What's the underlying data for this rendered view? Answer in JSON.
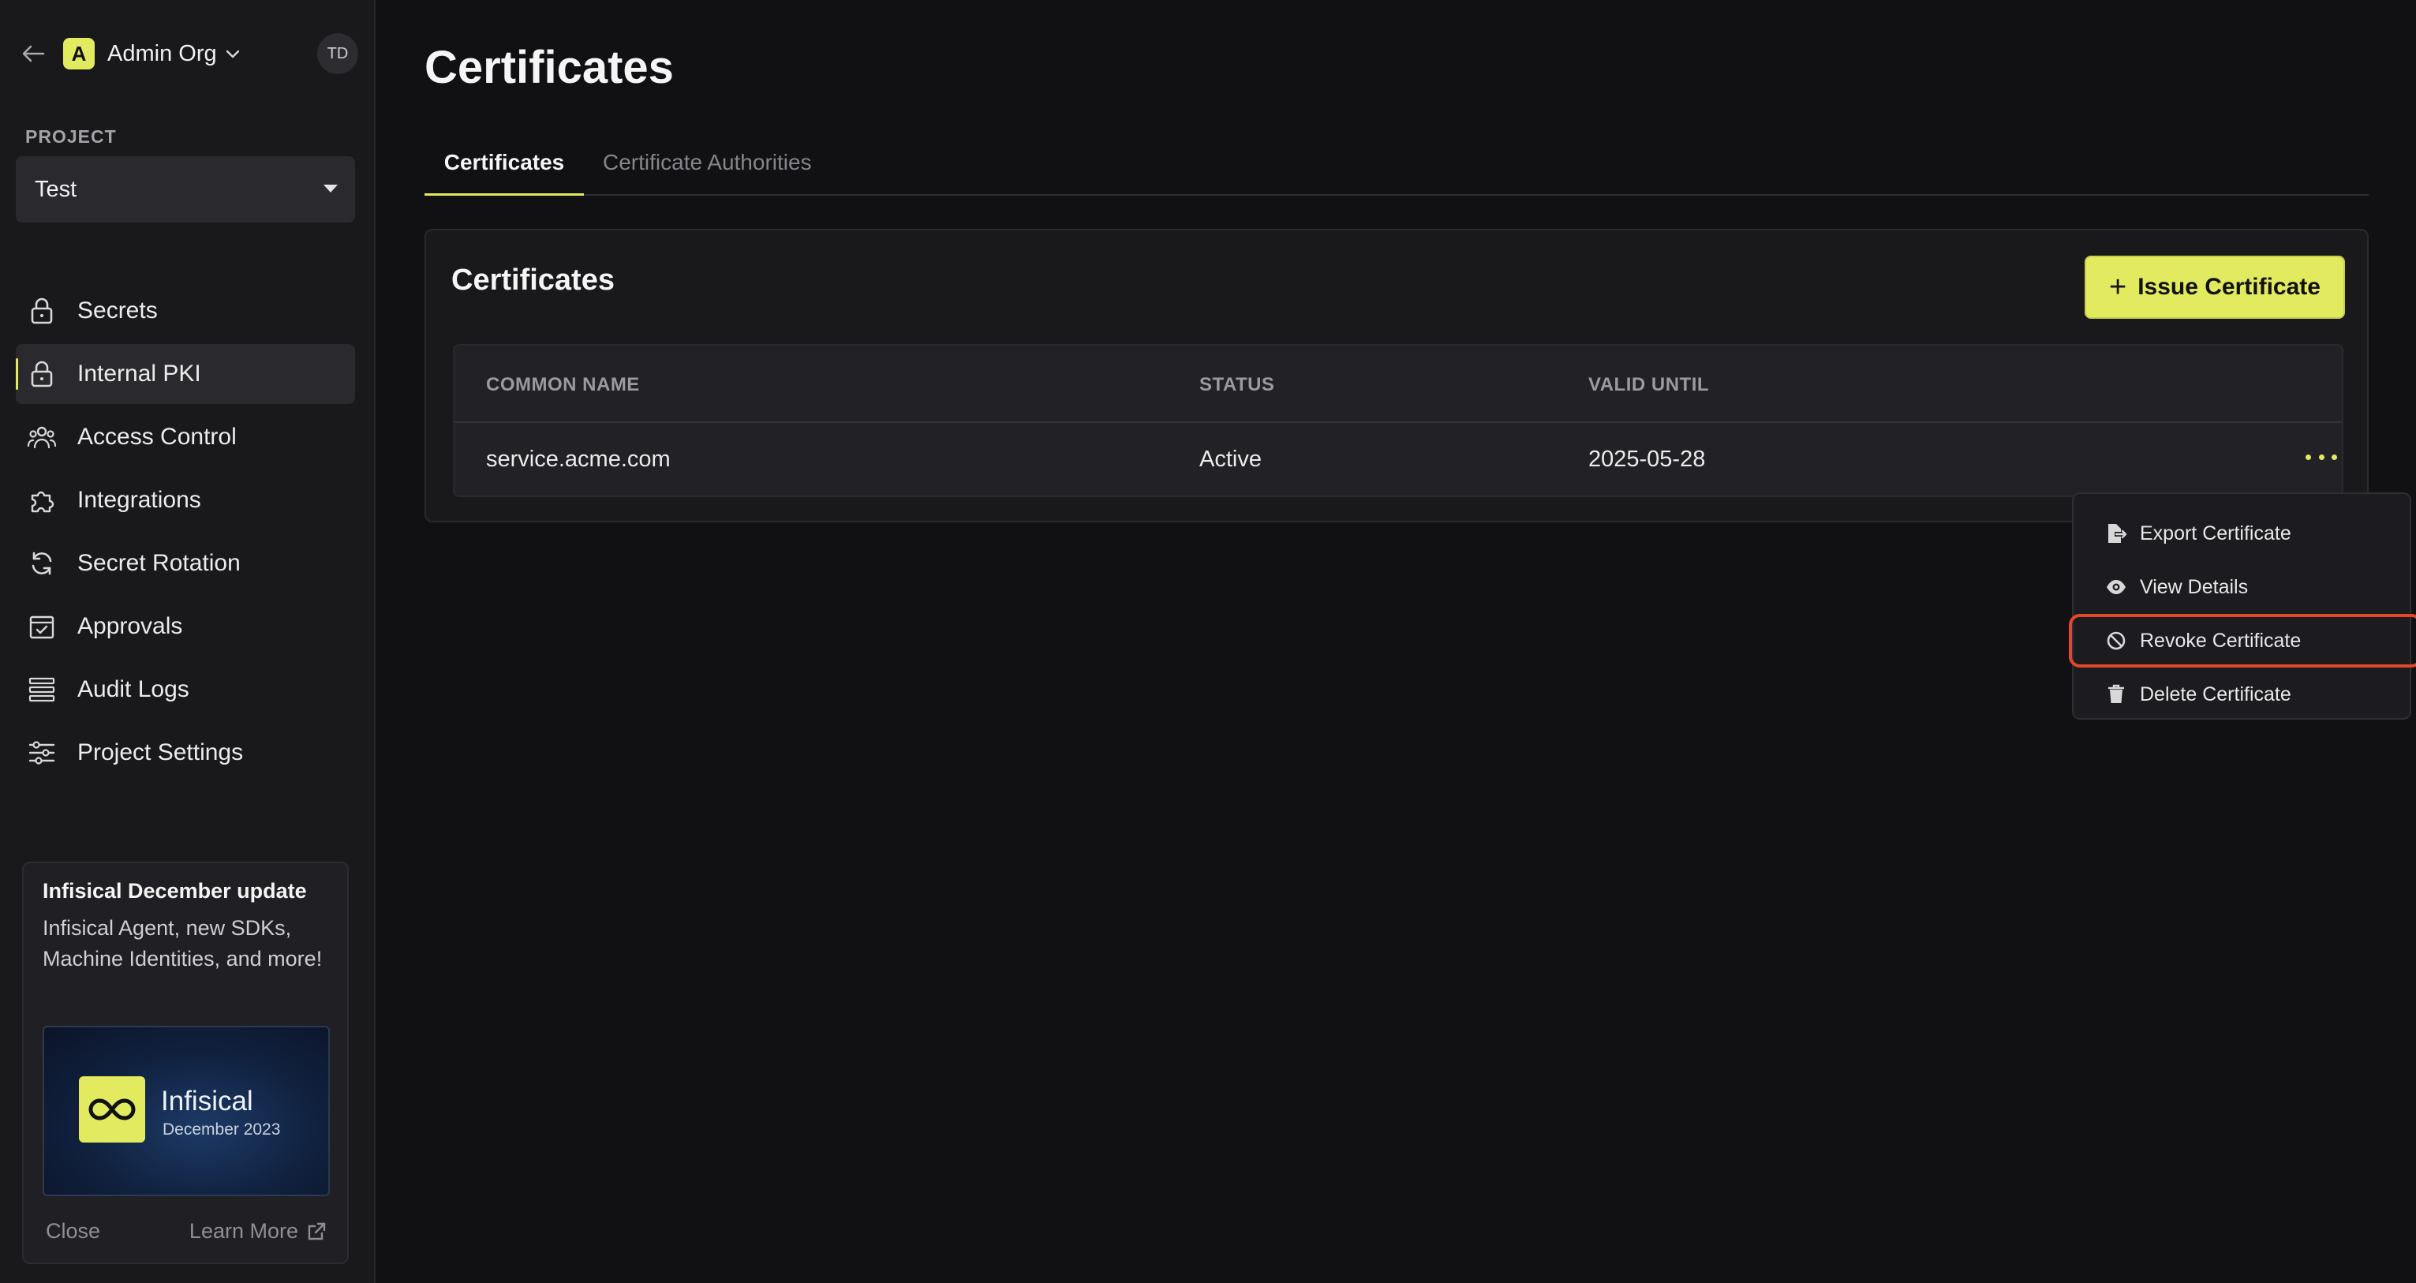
{
  "sidebar": {
    "org_initial": "A",
    "org_name": "Admin Org",
    "avatar_initials": "TD",
    "project_label": "PROJECT",
    "project_value": "Test",
    "nav": [
      {
        "label": "Secrets",
        "icon": "lock-icon"
      },
      {
        "label": "Internal PKI",
        "icon": "lock-icon",
        "active": true
      },
      {
        "label": "Access Control",
        "icon": "users-icon"
      },
      {
        "label": "Integrations",
        "icon": "puzzle-icon"
      },
      {
        "label": "Secret Rotation",
        "icon": "rotate-icon"
      },
      {
        "label": "Approvals",
        "icon": "calendar-check-icon"
      },
      {
        "label": "Audit Logs",
        "icon": "list-icon"
      },
      {
        "label": "Project Settings",
        "icon": "sliders-icon"
      }
    ],
    "update_card": {
      "title": "Infisical December update",
      "text": "Infisical Agent, new SDKs, Machine Identities, and more!",
      "brand_name": "Infisical",
      "brand_sub": "December 2023",
      "close_label": "Close",
      "learn_more_label": "Learn More"
    }
  },
  "main": {
    "title": "Certificates",
    "tabs": [
      {
        "label": "Certificates",
        "active": true
      },
      {
        "label": "Certificate Authorities",
        "active": false
      }
    ],
    "panel": {
      "title": "Certificates",
      "issue_button_label": "Issue Certificate",
      "columns": [
        "COMMON NAME",
        "STATUS",
        "VALID UNTIL"
      ],
      "rows": [
        {
          "common_name": "service.acme.com",
          "status": "Active",
          "valid_until": "2025-05-28"
        }
      ]
    },
    "row_menu": {
      "items": [
        {
          "label": "Export Certificate",
          "icon": "file-export-icon"
        },
        {
          "label": "View Details",
          "icon": "eye-icon"
        },
        {
          "label": "Revoke Certificate",
          "icon": "ban-icon",
          "highlighted": true
        },
        {
          "label": "Delete Certificate",
          "icon": "trash-icon"
        }
      ]
    }
  },
  "colors": {
    "accent": "#e2ea5f",
    "highlight_ring": "#e4472b",
    "background": "#111114",
    "sidebar": "#19191c"
  }
}
